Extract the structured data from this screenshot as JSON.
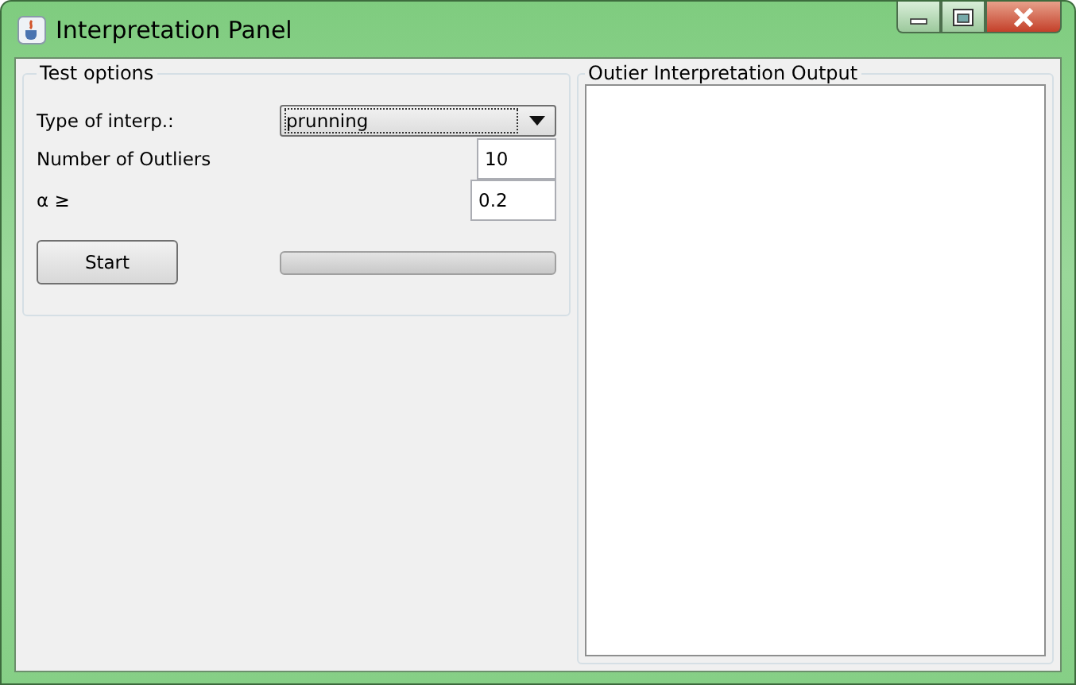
{
  "window": {
    "title": "Interpretation Panel"
  },
  "test_options": {
    "title": "Test options",
    "type_label": "Type of interp.:",
    "type_value": "prunning",
    "outliers_label": "Number of Outliers",
    "outliers_value": "10",
    "alpha_label": "α ≥",
    "alpha_value": "0.2",
    "start_button": "Start",
    "progress": {
      "level": 0
    }
  },
  "output": {
    "title": "Outier Interpretation Output"
  }
}
